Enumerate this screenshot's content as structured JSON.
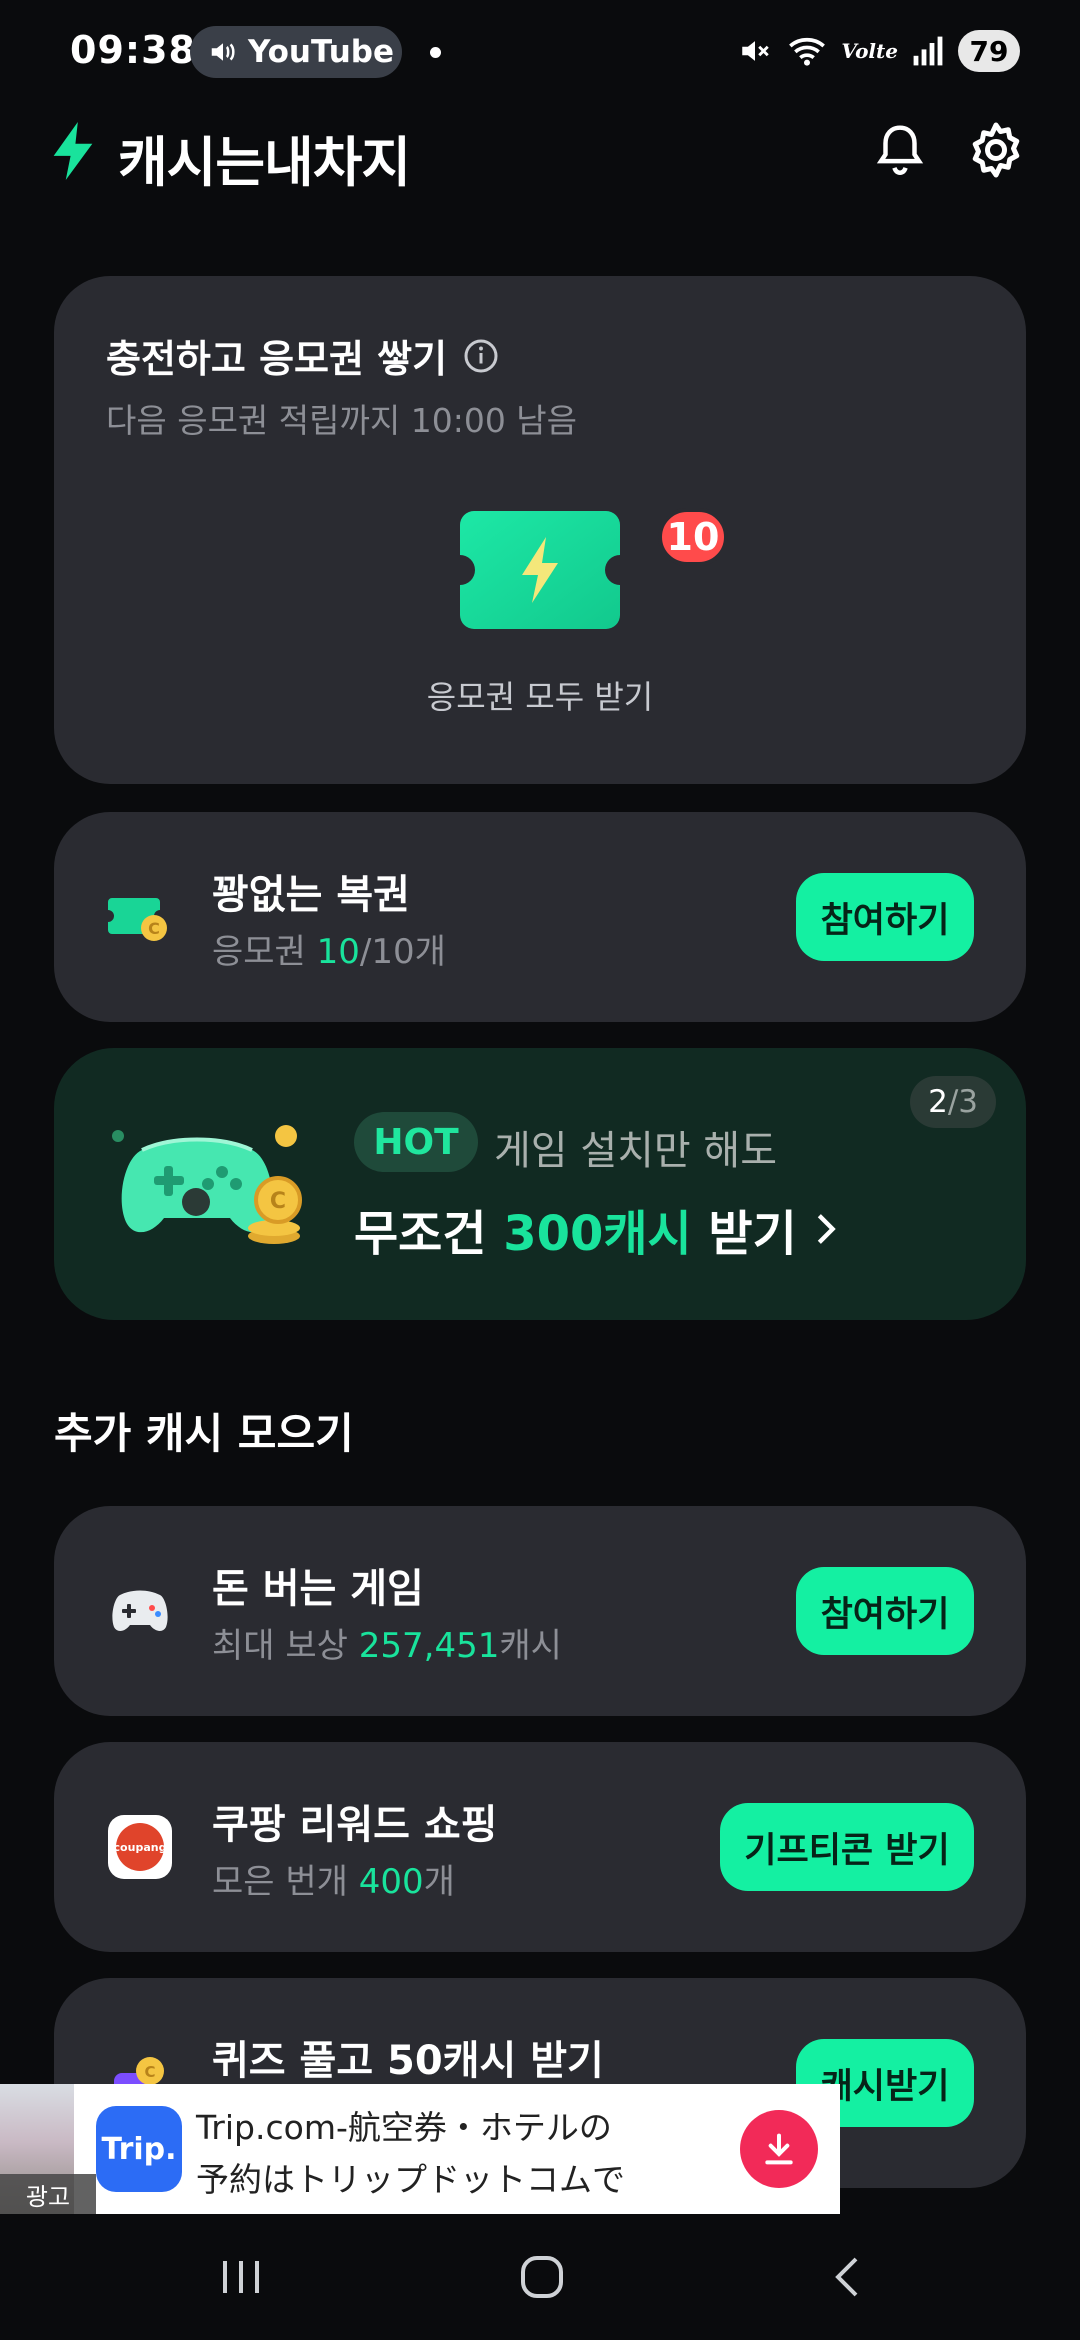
{
  "status_bar": {
    "time": "09:38",
    "media_app": "YouTube",
    "network_label": "Volte",
    "battery": "79"
  },
  "header": {
    "app_title": "캐시는내차지"
  },
  "charge_card": {
    "title": "충전하고 응모권 쌓기",
    "subtitle": "다음 응모권 적립까지 10:00 남음",
    "ticket_count": "10",
    "ticket_caption": "응모권 모두 받기"
  },
  "lottery": {
    "title": "꽝없는 복권",
    "sub_prefix": "응모권 ",
    "sub_current": "10",
    "sub_suffix": "/10개",
    "button": "참여하기"
  },
  "promo_banner": {
    "page_current": "2",
    "page_total": "/3",
    "hot_label": "HOT",
    "line1": "게임 설치만 해도",
    "line2_prefix": "무조건 ",
    "line2_accent": "300캐시",
    "line2_suffix": " 받기"
  },
  "extra_section": {
    "title": "추가 캐시 모으기",
    "items": [
      {
        "title": "돈 버는 게임",
        "sub_prefix": "최대 보상 ",
        "sub_accent": "257,451",
        "sub_suffix": "캐시",
        "button": "참여하기"
      },
      {
        "title": "쿠팡 리워드 쇼핑",
        "icon_text": "coupang",
        "sub_prefix": "모은 번개 ",
        "sub_accent": "400",
        "sub_suffix": "개",
        "button": "기프티콘 받기"
      },
      {
        "title": "퀴즈 풀고 50캐시 받기",
        "button": "캐시받기"
      }
    ]
  },
  "ad": {
    "label": "광고",
    "logo_text": "Trip.",
    "line1": "Trip.com-航空券・ホテルの",
    "line2": "予約はトリップドットコムで"
  },
  "colors": {
    "accent": "#19e39c",
    "button": "#14f0a2",
    "card": "#2a2b31",
    "background": "#0a0b0d",
    "badge": "#ff4b4b"
  },
  "icons": [
    "bolt-icon",
    "bell-icon",
    "gear-icon",
    "info-icon",
    "ticket-icon",
    "gamepad-icon",
    "coupang-icon",
    "quiz-icon",
    "download-icon",
    "chevron-right-icon"
  ]
}
